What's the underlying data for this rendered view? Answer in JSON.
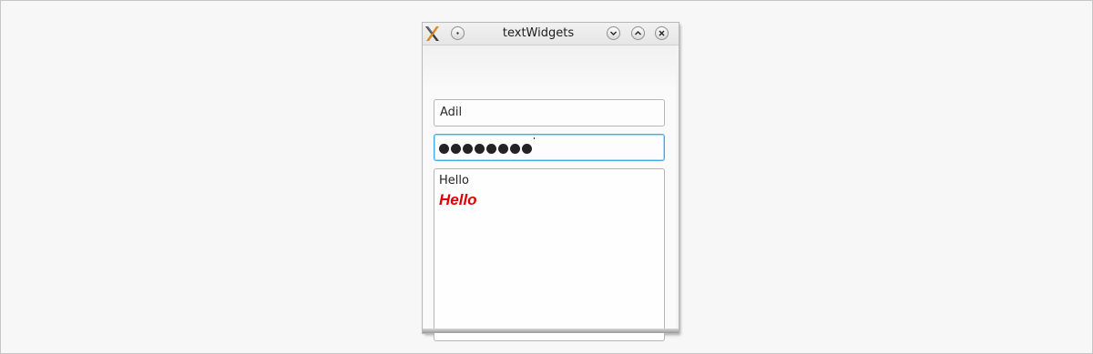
{
  "window": {
    "title": "textWidgets",
    "icons": {
      "app": "kde-x-app-icon",
      "menu": "window-menu-icon",
      "minimize": "minimize-icon",
      "maximize": "maximize-icon",
      "close": "close-icon"
    }
  },
  "name_field": {
    "value": "Adil"
  },
  "password_field": {
    "mask_char": "●",
    "masked_length": 8,
    "focused": true
  },
  "text_edit": {
    "plain_text": "Hello",
    "rich_text": "Hello",
    "rich_color": "#e00000",
    "rich_style": "bold italic"
  },
  "colors": {
    "focus_accent": "#3daee9",
    "rich_text": "#e00000"
  }
}
